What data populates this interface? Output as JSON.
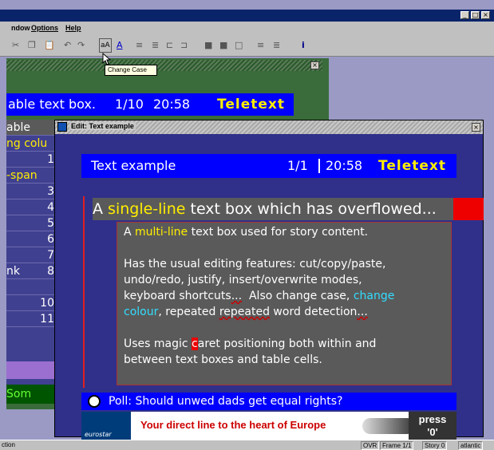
{
  "menu": {
    "window": "ndow",
    "options": "Options",
    "help": "Help"
  },
  "toolbar": {
    "tooltip": "Change Case"
  },
  "back": {
    "header_text": "able text box.",
    "header_page": "1/10",
    "header_time": "20:58",
    "logo": "Teletext",
    "table_title": "able",
    "table_subtitle": "ng colu",
    "rows": [
      {
        "label": "",
        "value": "1"
      },
      {
        "label": "-span",
        "value": ""
      },
      {
        "label": "",
        "value": "3"
      },
      {
        "label": "",
        "value": "4"
      },
      {
        "label": "",
        "value": "5"
      },
      {
        "label": "",
        "value": "6"
      },
      {
        "label": "",
        "value": "7"
      },
      {
        "label": "nk",
        "value": "8"
      },
      {
        "label": "",
        "value": ""
      },
      {
        "label": "",
        "value": "10"
      },
      {
        "label": "",
        "value": "11"
      }
    ],
    "bottom": "Som"
  },
  "front": {
    "window_title": "Edit: Text example",
    "header_title": "Text example",
    "page": "1/1",
    "time": "20:58",
    "logo": "Teletext",
    "headline_pre": "A ",
    "headline_hl": "single-line",
    "headline_post": " text box which has overflowed...",
    "story": {
      "p1_pre": "A ",
      "p1_hl": "multi-line",
      "p1_post": " text box used for story content.",
      "p2a": "Has the usual editing features: cut/copy/paste,",
      "p2b": "undo/redo, justify, insert/overwrite modes,",
      "p2c_pre": "keyboard shortcuts",
      "p2c_dots": "...",
      "p2c_mid": "  Also change case, ",
      "p2c_hl": "change",
      "p2d_hl": "colour",
      "p2d_mid": ", repeated ",
      "p2d_rep": "repeated",
      "p2d_post": " word detection",
      "p2d_dots": "...",
      "p3a_pre": "Uses magic ",
      "p3a_caret": "c",
      "p3a_post": "aret positioning both within and",
      "p3b": "between text boxes and table cells."
    },
    "poll": "Poll:  Should unwed dads get equal rights?",
    "ad_logo": "eurostar",
    "ad_text": "Your direct line to the heart of Europe",
    "ad_press_a": "press",
    "ad_press_b": "'0'"
  },
  "status": {
    "left": "ction",
    "mode": "OVR",
    "frame": "Frame 1/1",
    "story": "Story 0",
    "atlantic": "atlantic"
  }
}
